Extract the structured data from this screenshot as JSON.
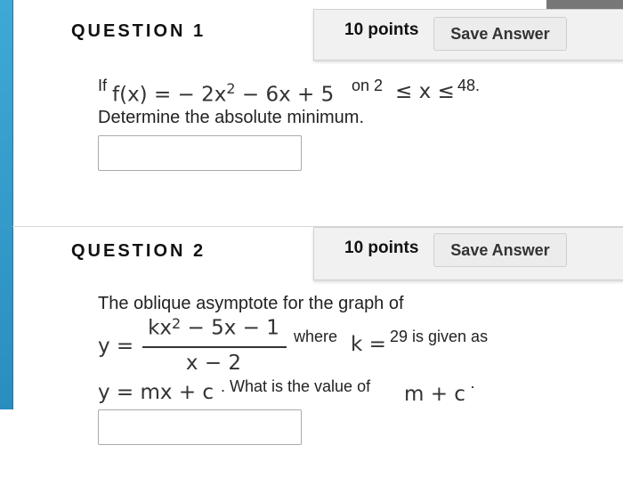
{
  "questions": [
    {
      "title": "QUESTION 1",
      "points": "10 points",
      "save_label": "Save Answer",
      "if": "If",
      "function": "f(x) = − 2x",
      "exp": "2",
      "function_rest": " − 6x + 5",
      "on_2": "on 2",
      "ineq": "≤ x ≤",
      "upper": "48.",
      "prompt": "Determine the absolute minimum.",
      "answer_value": ""
    },
    {
      "title": "QUESTION 2",
      "points": "10 points",
      "save_label": "Save Answer",
      "line1": "The oblique asymptote for the graph of",
      "y_eq": "y =",
      "numerator": "kx",
      "num_exp": "2",
      "numerator_rest": " − 5x − 1",
      "denominator": "x − 2",
      "where": "where",
      "k_eq": "k =",
      "k_value": "29 is given as",
      "mxc": "y = mx + c",
      "what": ". What is the value of",
      "m_c": "m + c",
      "dot": "·",
      "answer_value": ""
    }
  ]
}
